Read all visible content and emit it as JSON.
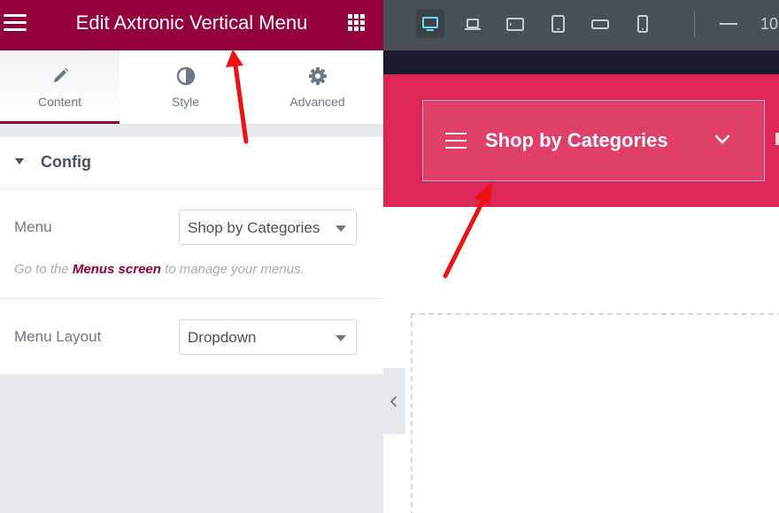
{
  "panel": {
    "title": "Edit Axtronic Vertical Menu",
    "tabs": [
      {
        "label": "Content",
        "icon": "pencil-icon",
        "active": true
      },
      {
        "label": "Style",
        "icon": "half-circle-icon",
        "active": false
      },
      {
        "label": "Advanced",
        "icon": "gear-icon",
        "active": false
      }
    ],
    "section": {
      "title": "Config",
      "menu_label": "Menu",
      "menu_value": "Shop by Categories",
      "help_prefix": "Go to the ",
      "help_link": "Menus screen",
      "help_suffix": " to manage your menus.",
      "layout_label": "Menu Layout",
      "layout_value": "Dropdown"
    }
  },
  "topbar": {
    "devices": [
      {
        "name": "desktop",
        "active": true
      },
      {
        "name": "laptop",
        "active": false
      },
      {
        "name": "tablet-landscape",
        "active": false
      },
      {
        "name": "tablet",
        "active": false
      },
      {
        "name": "mobile-landscape",
        "active": false
      },
      {
        "name": "mobile",
        "active": false
      }
    ],
    "zoom_text": "10"
  },
  "preview": {
    "menu_text": "Shop by Categories"
  },
  "colors": {
    "brand": "#93003c",
    "band": "#de2656",
    "arrow": "#ee1111"
  }
}
